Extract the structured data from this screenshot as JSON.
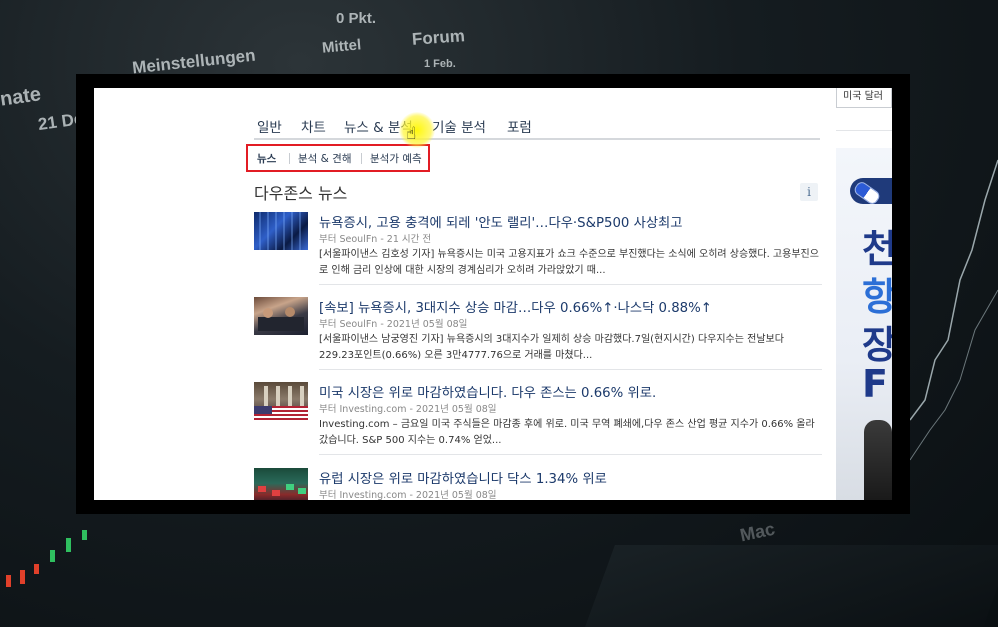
{
  "background": {
    "texts": [
      "0 Pkt.",
      "Mittel",
      "Forum",
      "nate",
      "21 De",
      "Meinstellungen",
      "1 Feb.",
      "Mac"
    ]
  },
  "tabs": [
    {
      "label": "일반"
    },
    {
      "label": "차트"
    },
    {
      "label": "뉴스 & 분석"
    },
    {
      "label": "기술 분석"
    },
    {
      "label": "포럼"
    }
  ],
  "subtabs": [
    {
      "label": "뉴스"
    },
    {
      "label": "분석 & 견해"
    },
    {
      "label": "분석가 예측"
    }
  ],
  "section_title": "다우존스 뉴스",
  "info_icon": "i",
  "articles": [
    {
      "headline": "뉴욕증시, 고용 충격에 되레 '안도 랠리'…다우·S&P500 사상최고",
      "meta": "부터 SeoulFn - 21 시간 전",
      "snippet": "[서울파이낸스 김호성 기자] 뉴욕증시는 미국 고용지표가 쇼크 수준으로 부진했다는 소식에 오히려 상승했다. 고용부진으로 인해 금리 인상에 대한 시장의 경계심리가 오히려 가라앉았기 때..."
    },
    {
      "headline": "[속보] 뉴욕증시, 3대지수 상승 마감…다우 0.66%↑·나스닥 0.88%↑",
      "meta": "부터 SeoulFn - 2021년 05월 08일",
      "snippet": "[서울파이낸스 남궁영진 기자] 뉴욕증시의 3대지수가 일제히 상승 마감했다.7일(현지시간) 다우지수는 전날보다 229.23포인트(0.66%) 오른 3만4777.76으로 거래를 마쳤다..."
    },
    {
      "headline": "미국 시장은 위로 마감하였습니다. 다우 존스는 0.66% 위로.",
      "meta": "부터 Investing.com - 2021년 05월 08일",
      "snippet": "Investing.com – 금요일 미국 주식들은 마감종 후에 위로. 미국 무역 폐쇄에,다우 존스 산업 평균 지수가 0.66% 올라갔습니다. S&P 500 지수는 0.74% 얻었..."
    },
    {
      "headline": "유럽 시장은 위로 마감하였습니다 닥스 1.34% 위로",
      "meta": "부터 Investing.com - 2021년 05월 08일",
      "snippet": ""
    }
  ],
  "right": {
    "search_text": "미국 달러",
    "ad_chars": [
      "천",
      "항",
      "장",
      "F"
    ]
  },
  "colors": {
    "highlight_box": "#e21c24",
    "headline": "#1c3a6b",
    "cursor_glow": "#fff800"
  }
}
